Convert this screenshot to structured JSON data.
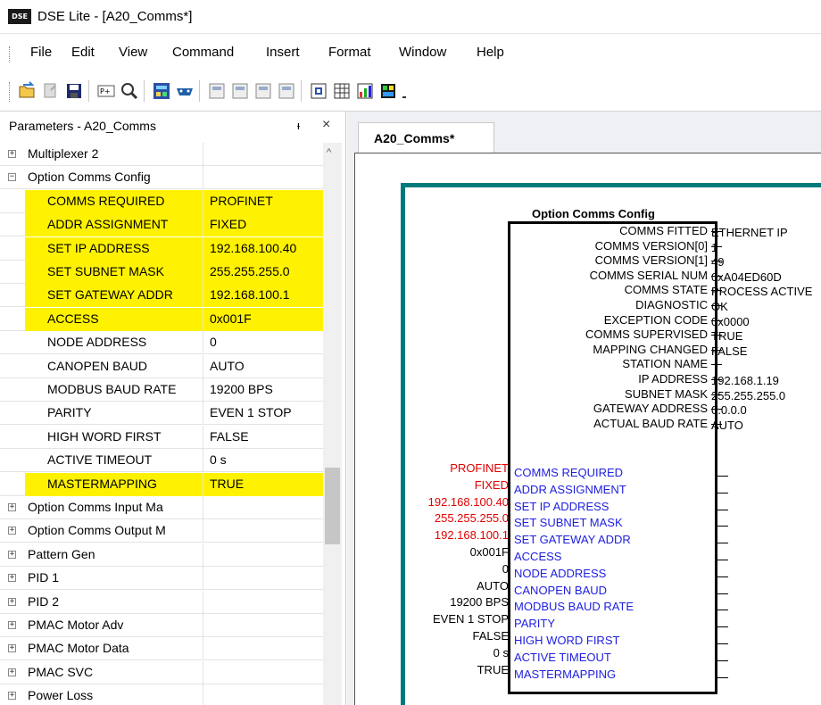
{
  "window": {
    "title": "DSE Lite - [A20_Comms*]",
    "logo": "DSE"
  },
  "menu": [
    {
      "label": "File"
    },
    {
      "label": "Edit"
    },
    {
      "label": "View"
    },
    {
      "label": "Command"
    },
    {
      "label": "Insert"
    },
    {
      "label": "Format"
    },
    {
      "label": "Window"
    },
    {
      "label": "Help"
    }
  ],
  "toolbar": {
    "icons": [
      "open-folder-icon",
      "new-icon",
      "save-icon",
      "properties-icon",
      "zoom-icon",
      "block-icon",
      "connect-icon",
      "page1-icon",
      "page2-icon",
      "page3-icon",
      "page4-icon",
      "grid-icon",
      "table-icon",
      "chart-icon",
      "palette-icon"
    ]
  },
  "panel": {
    "title": "Parameters - A20_Comms",
    "pin": "ᵻ",
    "close": "×",
    "rows": [
      {
        "label": "Multiplexer 2",
        "value": "",
        "type": "group",
        "expander": "+"
      },
      {
        "label": "Option Comms Config",
        "value": "",
        "type": "group",
        "expander": "−"
      },
      {
        "label": "COMMS REQUIRED",
        "value": "PROFINET",
        "type": "param",
        "highlight": true
      },
      {
        "label": "ADDR ASSIGNMENT",
        "value": "FIXED",
        "type": "param",
        "highlight": true
      },
      {
        "label": "SET IP ADDRESS",
        "value": "192.168.100.40",
        "type": "param",
        "highlight": true
      },
      {
        "label": "SET SUBNET MASK",
        "value": "255.255.255.0",
        "type": "param",
        "highlight": true
      },
      {
        "label": "SET GATEWAY ADDR",
        "value": "192.168.100.1",
        "type": "param",
        "highlight": true
      },
      {
        "label": "ACCESS",
        "value": "0x001F",
        "type": "param",
        "highlight": true
      },
      {
        "label": "NODE ADDRESS",
        "value": "0",
        "type": "param",
        "highlight": false
      },
      {
        "label": "CANOPEN BAUD",
        "value": "AUTO",
        "type": "param",
        "highlight": false
      },
      {
        "label": "MODBUS BAUD RATE",
        "value": "19200 BPS",
        "type": "param",
        "highlight": false
      },
      {
        "label": "PARITY",
        "value": "EVEN 1 STOP",
        "type": "param",
        "highlight": false
      },
      {
        "label": "HIGH WORD FIRST",
        "value": "FALSE",
        "type": "param",
        "highlight": false
      },
      {
        "label": "ACTIVE TIMEOUT",
        "value": "0 s",
        "type": "param",
        "highlight": false
      },
      {
        "label": "MASTERMAPPING",
        "value": "TRUE",
        "type": "param",
        "highlight": true
      },
      {
        "label": "Option Comms Input Ma",
        "value": "",
        "type": "group",
        "expander": "+"
      },
      {
        "label": "Option Comms Output M",
        "value": "",
        "type": "group",
        "expander": "+"
      },
      {
        "label": "Pattern Gen",
        "value": "",
        "type": "group",
        "expander": "+"
      },
      {
        "label": "PID 1",
        "value": "",
        "type": "group",
        "expander": "+"
      },
      {
        "label": "PID 2",
        "value": "",
        "type": "group",
        "expander": "+"
      },
      {
        "label": "PMAC Motor Adv",
        "value": "",
        "type": "group",
        "expander": "+"
      },
      {
        "label": "PMAC Motor Data",
        "value": "",
        "type": "group",
        "expander": "+"
      },
      {
        "label": "PMAC SVC",
        "value": "",
        "type": "group",
        "expander": "+"
      },
      {
        "label": "Power Loss",
        "value": "",
        "type": "group",
        "expander": "+"
      }
    ]
  },
  "document": {
    "tab": "A20_Comms*",
    "block_title": "Option Comms Config",
    "outputs": [
      {
        "label": "COMMS FITTED",
        "value": "ETHERNET IP"
      },
      {
        "label": "COMMS VERSION[0]",
        "value": "1"
      },
      {
        "label": "COMMS VERSION[1]",
        "value": "49"
      },
      {
        "label": "COMMS SERIAL NUM",
        "value": "0xA04ED60D"
      },
      {
        "label": "COMMS STATE",
        "value": "PROCESS ACTIVE"
      },
      {
        "label": "DIAGNOSTIC",
        "value": "OK"
      },
      {
        "label": "EXCEPTION CODE",
        "value": "0x0000"
      },
      {
        "label": "COMMS SUPERVISED",
        "value": "TRUE"
      },
      {
        "label": "MAPPING CHANGED",
        "value": "FALSE"
      },
      {
        "label": "STATION NAME",
        "value": ""
      },
      {
        "label": "IP ADDRESS",
        "value": "192.168.1.19"
      },
      {
        "label": "SUBNET MASK",
        "value": "255.255.255.0"
      },
      {
        "label": "GATEWAY ADDRESS",
        "value": "0.0.0.0"
      },
      {
        "label": "ACTUAL BAUD RATE",
        "value": "AUTO"
      }
    ],
    "inputs": [
      {
        "label": "COMMS REQUIRED",
        "value": "PROFINET",
        "changed": true
      },
      {
        "label": "ADDR ASSIGNMENT",
        "value": "FIXED",
        "changed": true
      },
      {
        "label": "SET IP ADDRESS",
        "value": "192.168.100.40",
        "changed": true
      },
      {
        "label": "SET SUBNET MASK",
        "value": "255.255.255.0",
        "changed": true
      },
      {
        "label": "SET GATEWAY ADDR",
        "value": "192.168.100.1",
        "changed": true
      },
      {
        "label": "ACCESS",
        "value": "0x001F",
        "changed": false
      },
      {
        "label": "NODE ADDRESS",
        "value": "0",
        "changed": false
      },
      {
        "label": "CANOPEN BAUD",
        "value": "AUTO",
        "changed": false
      },
      {
        "label": "MODBUS BAUD RATE",
        "value": "19200 BPS",
        "changed": false
      },
      {
        "label": "PARITY",
        "value": "EVEN 1 STOP",
        "changed": false
      },
      {
        "label": "HIGH WORD FIRST",
        "value": "FALSE",
        "changed": false
      },
      {
        "label": "ACTIVE TIMEOUT",
        "value": "0 s",
        "changed": false
      },
      {
        "label": "MASTERMAPPING",
        "value": "TRUE",
        "changed": false
      }
    ]
  },
  "colors": {
    "highlight": "#fff200",
    "input_label": "#2020e0",
    "changed_value": "#e00000",
    "frame": "#007a7a"
  }
}
